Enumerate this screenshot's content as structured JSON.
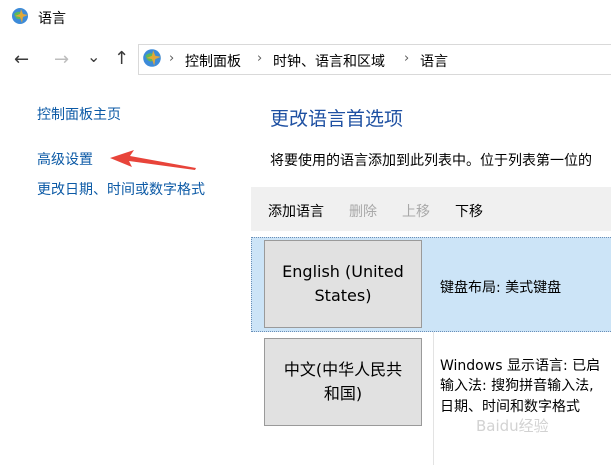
{
  "window": {
    "title": "语言",
    "icon": "control-panel-globe-icon"
  },
  "nav": {
    "back_icon": "←",
    "forward_icon": "→",
    "dropdown_icon": "⌄",
    "up_icon": "↑",
    "breadcrumb_sep": "›"
  },
  "breadcrumb": {
    "items": [
      "控制面板",
      "时钟、语言和区域",
      "语言"
    ]
  },
  "sidebar": {
    "items": [
      {
        "label": "控制面板主页"
      },
      {
        "label": "高级设置"
      },
      {
        "label": "更改日期、时间或数字格式"
      }
    ]
  },
  "main": {
    "title": "更改语言首选项",
    "description": "将要使用的语言添加到此列表中。位于列表第一位的",
    "toolbar": {
      "add_label": "添加语言",
      "remove_label": "删除",
      "move_up_label": "上移",
      "move_down_label": "下移"
    },
    "languages": [
      {
        "name_line1": "English (United",
        "name_line2": "States)",
        "details": [
          "键盘布局: 美式键盘"
        ],
        "selected": true
      },
      {
        "name_line1": "中文(中华人民共",
        "name_line2": "和国)",
        "details": [
          "Windows 显示语言: 已启",
          "输入法: 搜狗拼音输入法,",
          "日期、时间和数字格式"
        ],
        "selected": false
      }
    ]
  },
  "colors": {
    "link": "#0c5aa6",
    "title": "#1e50a2",
    "selected_row": "#cce4f7",
    "annotation_arrow": "#e8443a"
  },
  "watermark": "Baidu经验"
}
